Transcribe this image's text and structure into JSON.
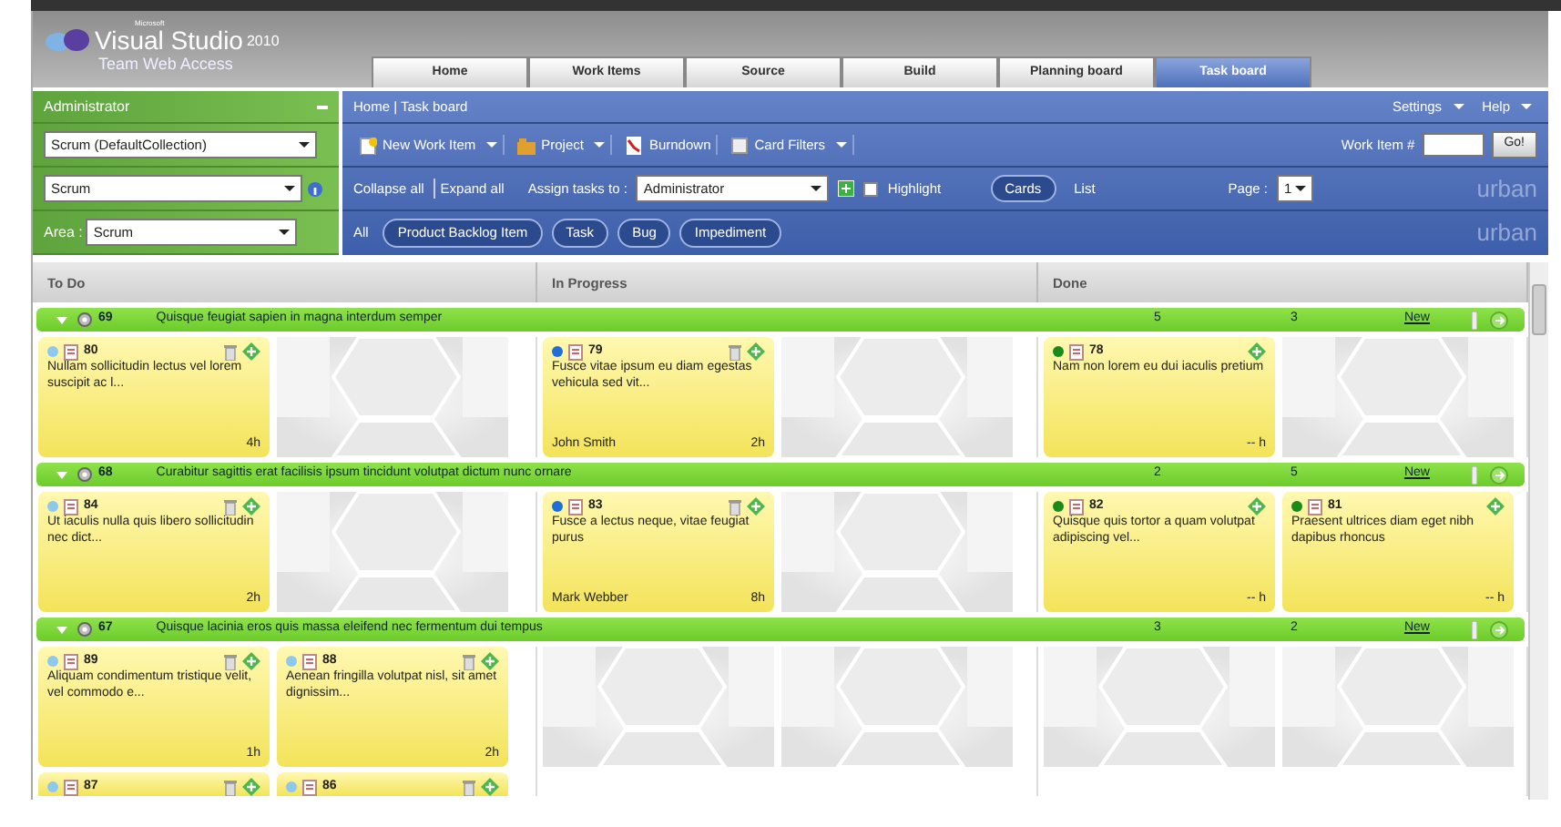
{
  "product": {
    "brand": "Microsoft",
    "name": "Visual Studio",
    "version": "2010",
    "subtitle": "Team Web Access"
  },
  "tabs": [
    {
      "label": "Home",
      "selected": false
    },
    {
      "label": "Work Items",
      "selected": false
    },
    {
      "label": "Source",
      "selected": false
    },
    {
      "label": "Build",
      "selected": false
    },
    {
      "label": "Planning board",
      "selected": false
    },
    {
      "label": "Task board",
      "selected": true
    }
  ],
  "sidebar": {
    "user": "Administrator",
    "collection": "Scrum (DefaultCollection)",
    "project": "Scrum",
    "area_label": "Area :",
    "area": "Scrum"
  },
  "breadcrumb": "Home | Task board",
  "header_links": [
    "Settings",
    "Help"
  ],
  "toolbar": {
    "items": [
      {
        "label": "New Work Item",
        "dropdown": true
      },
      {
        "label": "Project",
        "dropdown": true
      },
      {
        "label": "Burndown",
        "dropdown": false
      },
      {
        "label": "Card Filters",
        "dropdown": true
      }
    ],
    "work_item_label": "Work Item #",
    "go_button": "Go!"
  },
  "options": {
    "collapse": "Collapse all",
    "expand": "Expand all",
    "assign_label": "Assign tasks to :",
    "assignee": "Administrator",
    "highlight": {
      "label": "Highlight",
      "checked": false
    },
    "views": [
      {
        "label": "Cards",
        "selected": true
      },
      {
        "label": "List",
        "selected": false
      }
    ],
    "page_label": "Page :",
    "page": "1",
    "logo_text": "urban"
  },
  "filters": {
    "all": "All",
    "logo_text": "urban",
    "types": [
      "Product Backlog Item",
      "Task",
      "Bug",
      "Impediment"
    ]
  },
  "board": {
    "columns": [
      {
        "title": "To Do",
        "kind": "todo"
      },
      {
        "title": "In Progress",
        "kind": "inprogress"
      },
      {
        "title": "Done",
        "kind": "done"
      }
    ],
    "groups": [
      {
        "id": "69",
        "title": "Quisque feugiat sapien in magna interdum semper",
        "expanded": true,
        "counts": [
          "5",
          "3"
        ],
        "new_link": "New",
        "cells": [
          [
            {
              "id": "80",
              "text": "Nullam sollicitudin lectus vel lorem suscipit ac l...",
              "remaining": "4h"
            }
          ],
          [
            {
              "id": "79",
              "text": "Fusce vitae ipsum eu diam egestas vehicula sed vit...",
              "assigned": "John Smith",
              "remaining": "2h"
            }
          ],
          [
            {
              "id": "78",
              "text": "Nam non lorem eu dui iaculis pretium",
              "remaining": "-- h"
            }
          ]
        ]
      },
      {
        "id": "68",
        "title": "Curabitur sagittis erat facilisis ipsum tincidunt volutpat dictum nunc ornare",
        "expanded": true,
        "counts": [
          "2",
          "5"
        ],
        "new_link": "New",
        "cells": [
          [
            {
              "id": "84",
              "text": "Ut iaculis nulla quis libero sollicitudin nec dict...",
              "remaining": "2h"
            }
          ],
          [
            {
              "id": "83",
              "text": "Fusce a lectus neque, vitae feugiat purus",
              "assigned": "Mark Webber",
              "remaining": "8h"
            }
          ],
          [
            {
              "id": "82",
              "text": "Quisque quis tortor a quam volutpat adipiscing vel...",
              "remaining": "-- h"
            },
            {
              "id": "81",
              "text": "Praesent ultrices diam eget nibh dapibus rhoncus",
              "remaining": "-- h"
            }
          ]
        ]
      },
      {
        "id": "67",
        "title": "Quisque lacinia eros quis massa eleifend nec fermentum dui tempus",
        "expanded": true,
        "counts": [
          "3",
          "2"
        ],
        "new_link": "New",
        "cells": [
          [
            {
              "id": "89",
              "text": "Aliquam condimentum tristique velit, vel commodo e...",
              "remaining": "1h"
            },
            {
              "id": "88",
              "text": "Aenean fringilla volutpat nisl, sit amet dignissim...",
              "remaining": "2h"
            },
            {
              "id": "87"
            },
            {
              "id": "86"
            }
          ],
          [],
          []
        ]
      }
    ]
  }
}
